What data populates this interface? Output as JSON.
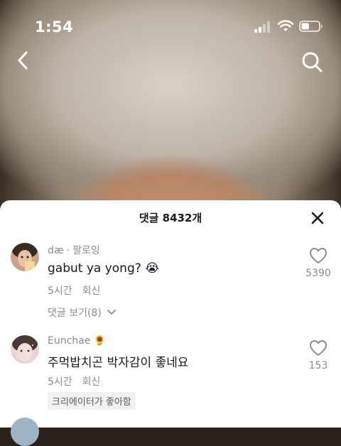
{
  "status_bar": {
    "time": "1:54",
    "battery_level": 0.45
  },
  "sheet": {
    "title": "댓글 8432개"
  },
  "comments": [
    {
      "username": "dæ",
      "relation": "팔로잉",
      "text": "gabut ya yong?",
      "emoji": "😭",
      "age": "5시간",
      "reply_label": "회신",
      "likes": "5390",
      "view_replies": "댓글 보기(8)"
    },
    {
      "username": "Eunchae",
      "name_emoji": "🌻",
      "text": "주먹밥치곤 박자감이 좋네요",
      "age": "5시간",
      "reply_label": "회신",
      "likes": "153",
      "creator_badge": "크리에이터가 좋아함"
    }
  ],
  "icons": {
    "back": "back-chevron-icon",
    "search": "search-icon",
    "close": "close-icon",
    "heart": "heart-outline-icon"
  }
}
